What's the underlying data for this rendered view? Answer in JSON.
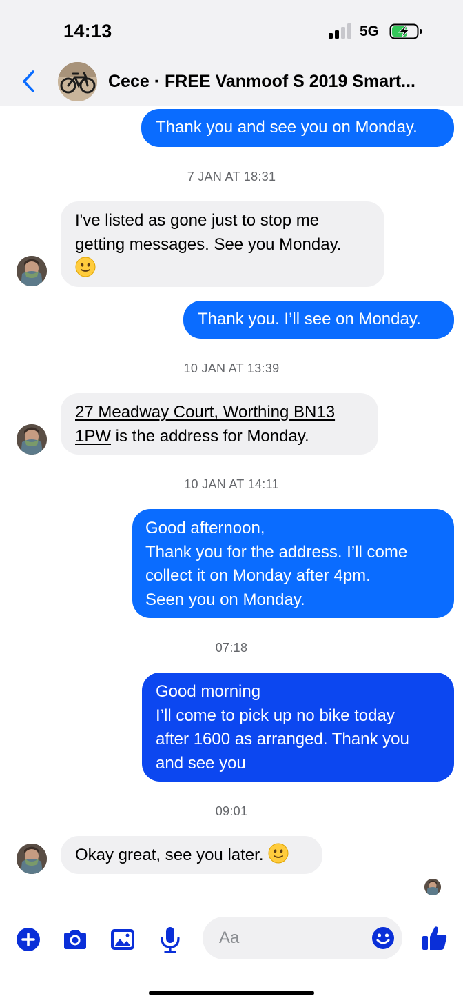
{
  "status_bar": {
    "time": "14:13",
    "network": "5G",
    "signal_bars": 2,
    "signal_bars_total": 4,
    "battery_charging": true,
    "battery_level": 0.5,
    "accent_color": "#34c759"
  },
  "header": {
    "title": "Cece · FREE Vanmoof  S 2019 Smart...",
    "back_icon": "chevron-left-icon",
    "accent_color": "#0a6cff"
  },
  "messages": [
    {
      "side": "outgoing",
      "lines": [
        "Thank you and see you on Monday."
      ]
    },
    {
      "type": "timestamp",
      "text": "7 JAN AT 18:31"
    },
    {
      "side": "incoming",
      "lines": [
        "I've listed as gone just to stop me",
        "getting messages. See you Monday."
      ],
      "emoji": "slightly-smiling-face"
    },
    {
      "side": "outgoing",
      "lines": [
        "Thank you. I’ll see on Monday."
      ]
    },
    {
      "type": "timestamp",
      "text": "10 JAN AT 13:39"
    },
    {
      "side": "incoming",
      "link_line_1": "27 Meadway Court, Worthing BN13",
      "link_line_2": "1PW",
      "rest_line_2": " is the address for Monday."
    },
    {
      "type": "timestamp",
      "text": "10 JAN AT 14:11"
    },
    {
      "side": "outgoing",
      "lines": [
        "Good afternoon,",
        "Thank you for the address. I’ll come",
        "collect it on Monday after 4pm.",
        "Seen you on Monday."
      ]
    },
    {
      "type": "timestamp",
      "text": "07:18"
    },
    {
      "side": "outgoing",
      "lines": [
        "Good morning",
        "I’ll come to pick up no bike today",
        "after 1600 as arranged. Thank you",
        "and see you"
      ]
    },
    {
      "type": "timestamp",
      "text": "09:01"
    },
    {
      "side": "incoming",
      "lines": [
        "Okay great, see you later. "
      ],
      "emoji": "slightly-smiling-face"
    }
  ],
  "composer": {
    "placeholder": "Aa",
    "icons": [
      "plus-icon",
      "camera-icon",
      "gallery-icon",
      "microphone-icon",
      "emoji-icon",
      "thumbs-up-icon"
    ],
    "icon_color": "#0a2fd8"
  },
  "colors": {
    "outgoing_bubble": "#0a6cff",
    "outgoing_bubble_latest": "#0c47f0",
    "incoming_bubble": "#f0f0f2",
    "timestamp": "#65676b"
  }
}
